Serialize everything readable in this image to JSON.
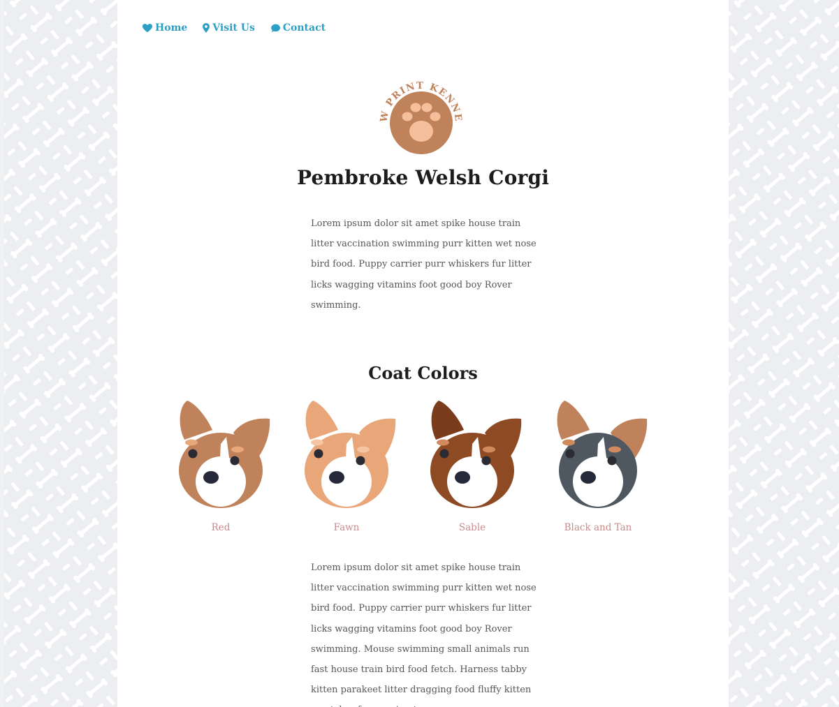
{
  "nav": {
    "items": [
      {
        "label": "Home",
        "icon": "heart-icon"
      },
      {
        "label": "Visit Us",
        "icon": "map-pin-icon"
      },
      {
        "label": "Contact",
        "icon": "chat-bubble-icon"
      }
    ]
  },
  "logo": {
    "text": "PAW PRINT KENNELS",
    "icon": "paw-print-icon"
  },
  "breed": {
    "title": "Pembroke Welsh Corgi",
    "intro": "Lorem ipsum dolor sit amet spike house train litter vaccination swimming purr kitten wet nose bird food. Puppy carrier purr whiskers fur litter licks wagging vitamins foot good boy Rover swimming."
  },
  "coat_colors": {
    "title": "Coat Colors",
    "items": [
      {
        "label": "Red",
        "icon": "corgi-red-icon"
      },
      {
        "label": "Fawn",
        "icon": "corgi-fawn-icon"
      },
      {
        "label": "Sable",
        "icon": "corgi-sable-icon"
      },
      {
        "label": "Black and Tan",
        "icon": "corgi-black-and-tan-icon"
      }
    ]
  },
  "details": {
    "text": "Lorem ipsum dolor sit amet spike house train litter vaccination swimming purr kitten wet nose bird food. Puppy carrier purr whiskers fur litter licks wagging vitamins foot good boy Rover swimming. Mouse swimming small animals run fast house train bird food fetch. Harness tabby kitten parakeet litter dragging food fluffy kitten scratcher fur running toy."
  },
  "colors": {
    "link": "#2d9fc4",
    "logo_brown": "#c0825a",
    "logo_pad": "#f6bf9c",
    "heading": "#1c1c1c",
    "body_text": "#555555",
    "coat_label": "#c98b8b",
    "background_pattern": "#f0f1f3",
    "red_coat": "#c0825a",
    "fawn_coat": "#e8a679",
    "sable_coat": "#8e4a22",
    "black_coat": "#4f5861"
  }
}
